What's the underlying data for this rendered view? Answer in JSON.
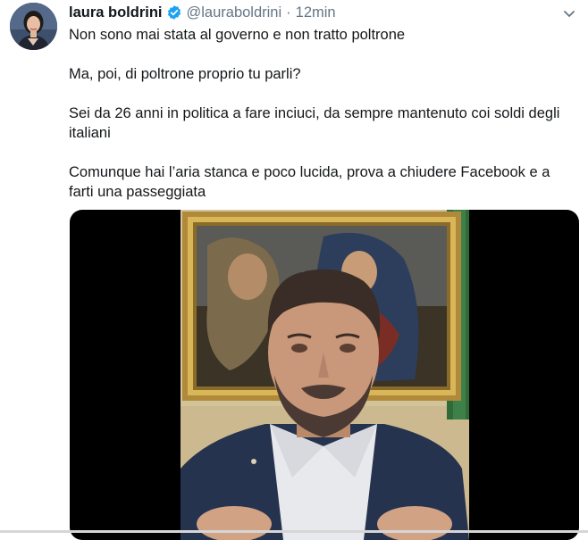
{
  "tweet": {
    "author": {
      "name": "laura boldrini",
      "handle": "@lauraboldrini",
      "verified": true,
      "avatar_icon": "profile-photo"
    },
    "separator": "·",
    "time": "12min",
    "menu_icon": "chevron-down-icon",
    "paragraphs": [
      "Non sono mai stata al governo e non tratto poltrone",
      "Ma, poi, di poltrone proprio tu parli?",
      "Sei da 26 anni in politica a fare inciuci, da sempre mantenuto coi soldi degli italiani",
      "Comunque hai l’aria stanca e poco lucida, prova a chiudere Facebook e a farti una passeggiata"
    ],
    "media": {
      "type": "video",
      "icon": "video-thumbnail"
    }
  },
  "colors": {
    "text": "#14171a",
    "secondary": "#657786",
    "verified": "#1da1f2",
    "media_bg": "#000000"
  }
}
